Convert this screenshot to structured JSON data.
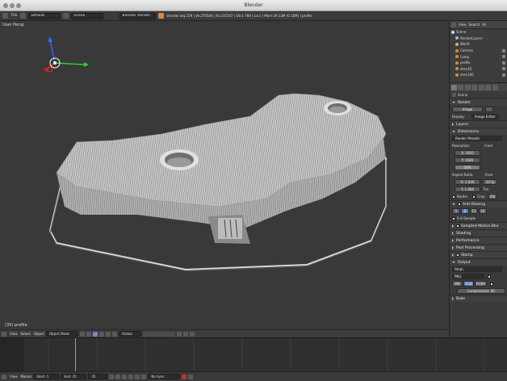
{
  "window": {
    "title": "Blender"
  },
  "info_header": {
    "layout": "Default",
    "scene": "Scene",
    "engine": "Blender Render",
    "stats": "blender.org 259 | Ve:270504 | Fa:235547 | Ob:1-784 | La:1 | Mem:39.13M (0.10M) | profile"
  },
  "viewport": {
    "view_label": "User Persp",
    "object_label": "(35) profile",
    "colors": {
      "background": "#393939",
      "model": "#c4c4c4",
      "model_shadow": "#8c8c8c",
      "wire": "#d8d8d8"
    }
  },
  "viewport_header": {
    "mode": "Object Mode",
    "orientation": "Global"
  },
  "timeline_header": {
    "start": "Start: 1",
    "end": "End: 35",
    "current": "35",
    "sync": "No Sync"
  },
  "outliner": {
    "header": {
      "view": "View",
      "search": "Search",
      "all": "All"
    },
    "items": [
      {
        "label": "Scene",
        "color": "#d7d7d7"
      },
      {
        "label": "RenderLayers",
        "color": "#9bb7e0"
      },
      {
        "label": "World",
        "color": "#d8b04a"
      },
      {
        "label": "Camera",
        "color": "#d88a3a"
      },
      {
        "label": "Lamp",
        "color": "#d88a3a"
      },
      {
        "label": "profile",
        "color": "#d88a3a"
      },
      {
        "label": "dren10",
        "color": "#d88a3a"
      },
      {
        "label": "dren100",
        "color": "#d88a3a"
      }
    ]
  },
  "properties": {
    "context": "Scene",
    "render_panel": "Render",
    "render_image": "Image",
    "display_label": "Display:",
    "display_value": "Image Editor",
    "layers_panel": "Layers",
    "dimensions_panel": "Dimensions",
    "presets": "Render Presets",
    "resolution_label": "Resolution:",
    "resx": "X: 1920",
    "resy": "Y: 1080",
    "res_pct": "50%",
    "frame_label": "Fram",
    "aspect_label": "Aspect Ratio:",
    "aspx": "X: 1.000",
    "aspy": "Y: 1.000",
    "framerate_label": "Fram",
    "fps": "24 fp",
    "time": "Tim",
    "border": "Border",
    "crop": "Crop",
    "old": "Old",
    "aa_panel": "Anti-Aliasing",
    "aa_samples": [
      "5",
      "8",
      "11",
      "16"
    ],
    "full_sample": "Full Sample",
    "motion_blur": "Sampled Motion Blur",
    "shading": "Shading",
    "performance": "Performance",
    "post": "Post Processing",
    "stamp": "Stamp",
    "output": "Output",
    "output_path": "/tmp\\",
    "format": "PNG",
    "bw": "BW",
    "rgb": "RGB",
    "rgba": "RGBA",
    "compression": "Compression: 90",
    "bake": "Bake"
  }
}
